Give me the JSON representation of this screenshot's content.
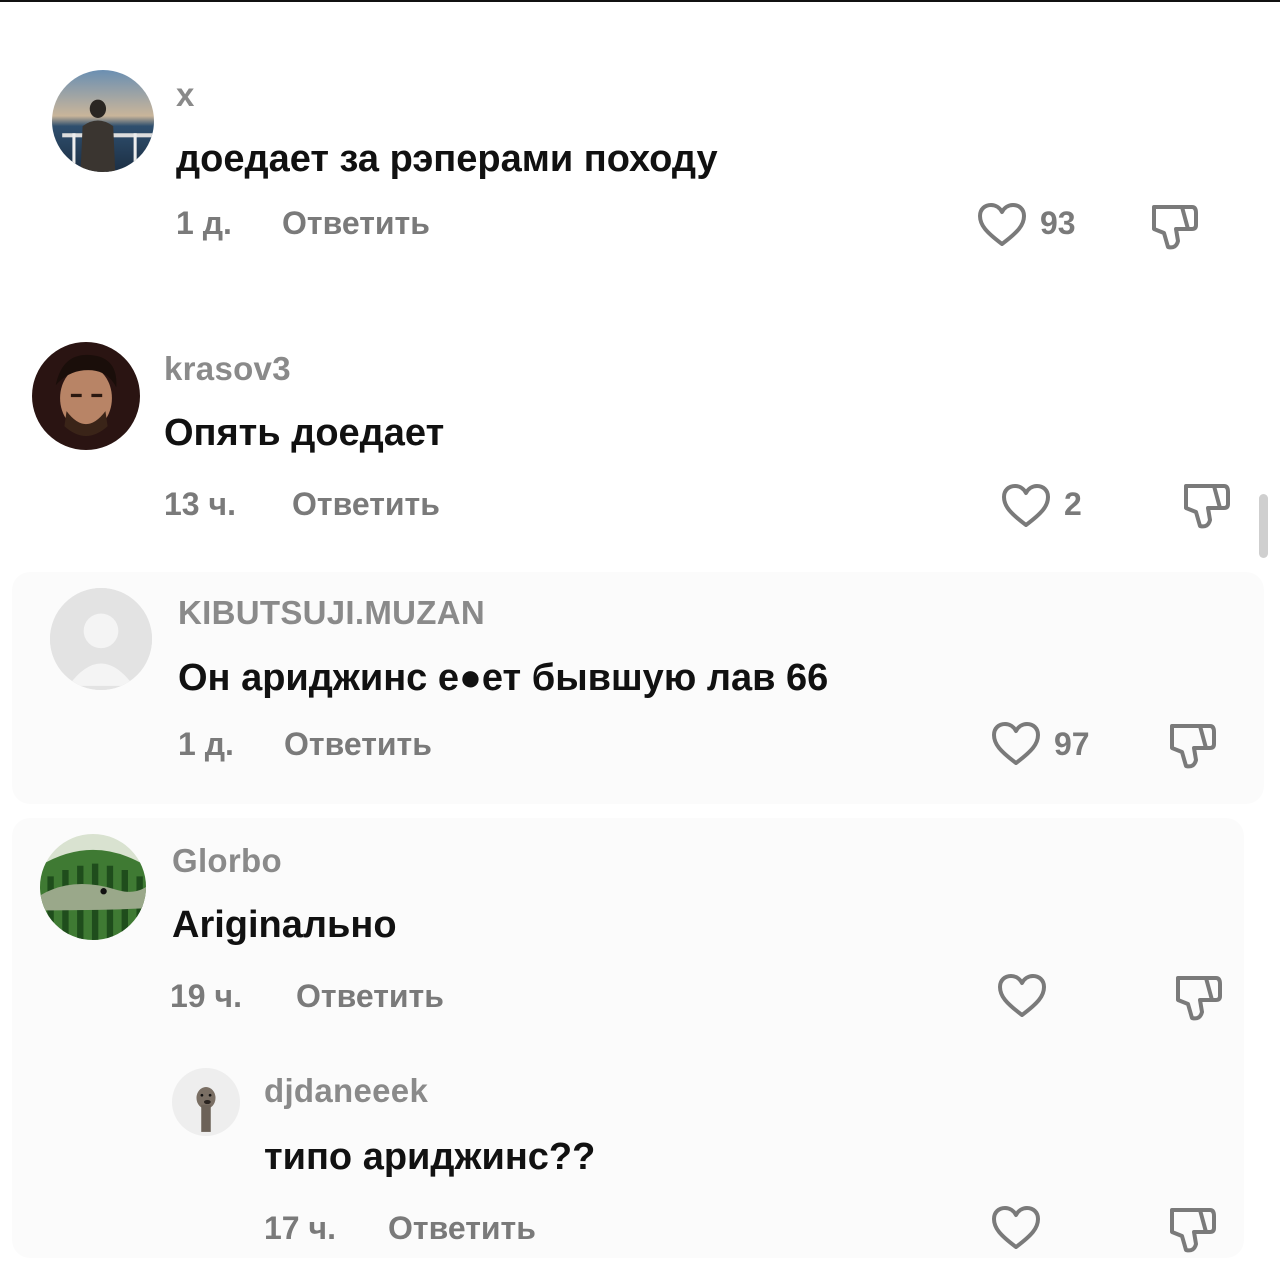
{
  "comments": [
    {
      "username": "x",
      "text": "доедает за рэперами походу",
      "time": "1 д.",
      "reply": "Ответить",
      "likes": "93"
    },
    {
      "username": "krasov3",
      "text": "Опять доедает",
      "time": "13 ч.",
      "reply": "Ответить",
      "likes": "2"
    },
    {
      "username": "KIBUTSUJI.MUZAN",
      "text": "Он ариджинс е●ет бывшую лав 66",
      "time": "1 д.",
      "reply": "Ответить",
      "likes": "97"
    },
    {
      "username": "Glorbo",
      "text": "Ariginально",
      "time": "19 ч.",
      "reply": "Ответить",
      "likes": ""
    },
    {
      "username": "djdaneeek",
      "text": "типо ариджинс??",
      "time": "17 ч.",
      "reply": "Ответить",
      "likes": ""
    }
  ],
  "icons": {
    "like": "heart-outline-icon",
    "dislike": "thumbs-down-outline-icon"
  },
  "colors": {
    "secondary_text": "#7a7a7a",
    "username": "#8a8a8a",
    "primary_text": "#111111"
  }
}
